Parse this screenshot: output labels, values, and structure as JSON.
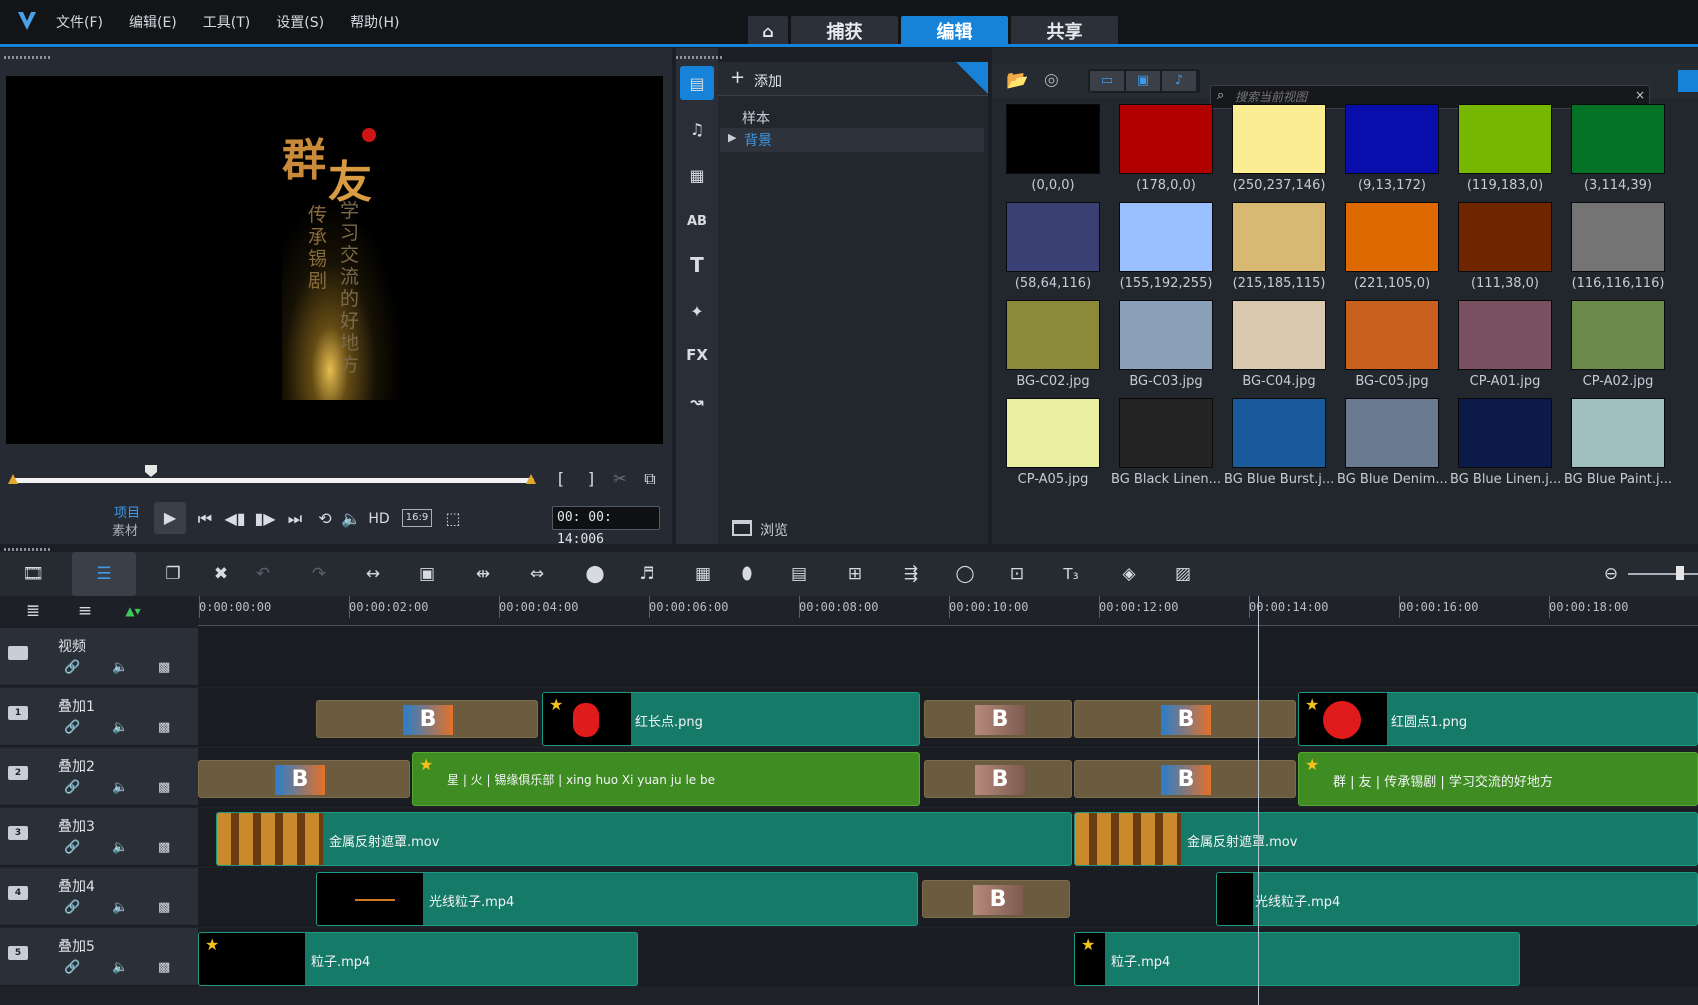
{
  "menu": [
    "文件(F)",
    "编辑(E)",
    "工具(T)",
    "设置(S)",
    "帮助(H)"
  ],
  "step_tabs": [
    {
      "label": "捕获"
    },
    {
      "label": "编辑"
    },
    {
      "label": "共享"
    }
  ],
  "preview": {
    "mode_project": "项目",
    "mode_clip": "素材",
    "hd": "HD",
    "aspect": "16:9",
    "timecode": "00: 00: 14:006",
    "overlay_text": [
      "群",
      "友",
      "传承锡剧",
      "学习交流的好地方"
    ]
  },
  "library": {
    "add_label": "添加",
    "folders": [
      "样本",
      "背景"
    ],
    "browse": "浏览",
    "search_placeholder": "搜索当前视图"
  },
  "thumbs": [
    {
      "caption": "(0,0,0)",
      "color": "#000000"
    },
    {
      "caption": "(178,0,0)",
      "color": "#b20000"
    },
    {
      "caption": "(250,237,146)",
      "color": "#faed92"
    },
    {
      "caption": "(9,13,172)",
      "color": "#090dac"
    },
    {
      "caption": "(119,183,0)",
      "color": "#77b700"
    },
    {
      "caption": "(3,114,39)",
      "color": "#037227"
    },
    {
      "caption": "(58,64,116)",
      "color": "#3a4074"
    },
    {
      "caption": "(155,192,255)",
      "color": "#9bc0ff"
    },
    {
      "caption": "(215,185,115)",
      "color": "#d7b973"
    },
    {
      "caption": "(221,105,0)",
      "color": "#dd6900"
    },
    {
      "caption": "(111,38,0)",
      "color": "#6f2600"
    },
    {
      "caption": "(116,116,116)",
      "color": "#747474"
    },
    {
      "caption": "BG-C02.jpg",
      "color": "#8a8a3a"
    },
    {
      "caption": "BG-C03.jpg",
      "color": "#8aa0b8"
    },
    {
      "caption": "BG-C04.jpg",
      "color": "#d8c8b0"
    },
    {
      "caption": "BG-C05.jpg",
      "color": "#c86020"
    },
    {
      "caption": "CP-A01.jpg",
      "color": "#7a5060"
    },
    {
      "caption": "CP-A02.jpg",
      "color": "#6a8a4a"
    },
    {
      "caption": "CP-A05.jpg",
      "color": "#e8f0a0"
    },
    {
      "caption": "BG Black Linen...",
      "color": "#232323"
    },
    {
      "caption": "BG Blue Burst.j...",
      "color": "#1a5a9a"
    },
    {
      "caption": "BG Blue Denim...",
      "color": "#6a7a90"
    },
    {
      "caption": "BG Blue Linen.j...",
      "color": "#0c1a4a"
    },
    {
      "caption": "BG Blue Paint.j...",
      "color": "#a0c0c0"
    }
  ],
  "ruler": [
    "0:00:00:00",
    "00:00:02:00",
    "00:00:04:00",
    "00:00:06:00",
    "00:00:08:00",
    "00:00:10:00",
    "00:00:12:00",
    "00:00:14:00",
    "00:00:16:00",
    "00:00:18:00"
  ],
  "tracks": [
    {
      "name": "视频",
      "clips": []
    },
    {
      "name": "叠加1",
      "clips": [
        {
          "label": "红长点.png"
        },
        {
          "label": "红圆点1.png"
        }
      ]
    },
    {
      "name": "叠加2",
      "clips": [
        {
          "label": "星 | 火 | 锡缘俱乐部 | xing huo Xi yuan ju le be"
        },
        {
          "label": "群 | 友 | 传承锡剧 | 学习交流的好地方"
        }
      ]
    },
    {
      "name": "叠加3",
      "clips": [
        {
          "label": "金属反射遮罩.mov"
        },
        {
          "label": "金属反射遮罩.mov"
        }
      ]
    },
    {
      "name": "叠加4",
      "clips": [
        {
          "label": "光线粒子.mp4"
        },
        {
          "label": "光线粒子.mp4"
        }
      ]
    },
    {
      "name": "叠加5",
      "clips": [
        {
          "label": "粒子.mp4"
        },
        {
          "label": "粒子.mp4"
        }
      ]
    }
  ]
}
